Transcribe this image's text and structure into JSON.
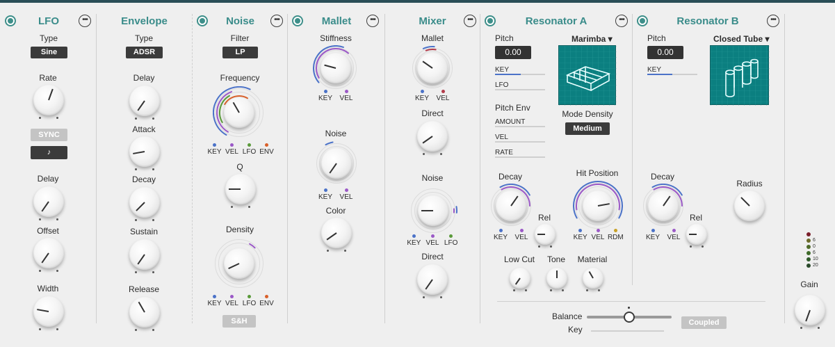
{
  "lfo": {
    "title": "LFO",
    "type_label": "Type",
    "type_value": "Sine",
    "rate_label": "Rate",
    "sync_label": "SYNC",
    "note_label": "♪",
    "delay_label": "Delay",
    "offset_label": "Offset",
    "width_label": "Width"
  },
  "envelope": {
    "title": "Envelope",
    "type_label": "Type",
    "type_value": "ADSR",
    "delay_label": "Delay",
    "attack_label": "Attack",
    "decay_label": "Decay",
    "sustain_label": "Sustain",
    "release_label": "Release"
  },
  "noise": {
    "title": "Noise",
    "filter_label": "Filter",
    "filter_value": "LP",
    "frequency_label": "Frequency",
    "q_label": "Q",
    "density_label": "Density",
    "sh_label": "S&H",
    "mods": [
      "KEY",
      "VEL",
      "LFO",
      "ENV"
    ]
  },
  "mallet": {
    "title": "Mallet",
    "stiffness_label": "Stiffness",
    "noise_label": "Noise",
    "color_label": "Color",
    "mods": [
      "KEY",
      "VEL"
    ]
  },
  "mixer": {
    "title": "Mixer",
    "mallet_label": "Mallet",
    "direct1_label": "Direct",
    "noise_label": "Noise",
    "direct2_label": "Direct",
    "mods2": [
      "KEY",
      "VEL"
    ],
    "mods3": [
      "KEY",
      "VEL",
      "LFO"
    ]
  },
  "resonator_a": {
    "title": "Resonator A",
    "pitch_label": "Pitch",
    "pitch_value": "0.00",
    "key_label": "KEY",
    "lfo_label": "LFO",
    "pitch_env_label": "Pitch Env",
    "amount_label": "AMOUNT",
    "vel_label": "VEL",
    "rate_label": "RATE",
    "model": "Marimba ▾",
    "mode_density_label": "Mode Density",
    "mode_density_value": "Medium",
    "decay_label": "Decay",
    "rel_label": "Rel",
    "hit_position_label": "Hit Position",
    "low_cut_label": "Low Cut",
    "tone_label": "Tone",
    "material_label": "Material",
    "decay_mods": [
      "KEY",
      "VEL"
    ],
    "hit_mods": [
      "KEY",
      "VEL",
      "RDM"
    ]
  },
  "resonator_b": {
    "title": "Resonator B",
    "pitch_label": "Pitch",
    "pitch_value": "0.00",
    "key_label": "KEY",
    "model": "Closed Tube ▾",
    "decay_label": "Decay",
    "rel_label": "Rel",
    "radius_label": "Radius",
    "decay_mods": [
      "KEY",
      "VEL"
    ]
  },
  "bottom": {
    "balance_label": "Balance",
    "key_label": "Key",
    "coupled_label": "Coupled"
  },
  "output": {
    "gain_label": "Gain",
    "meter_labels": [
      "6",
      "0",
      "6",
      "10",
      "20"
    ]
  },
  "colors": {
    "accent": "#3a8c8a",
    "key": "#4b72c8",
    "vel": "#9b59c7",
    "lfo": "#5a9a3a",
    "env": "#d9602a",
    "rdm": "#c9a227"
  }
}
